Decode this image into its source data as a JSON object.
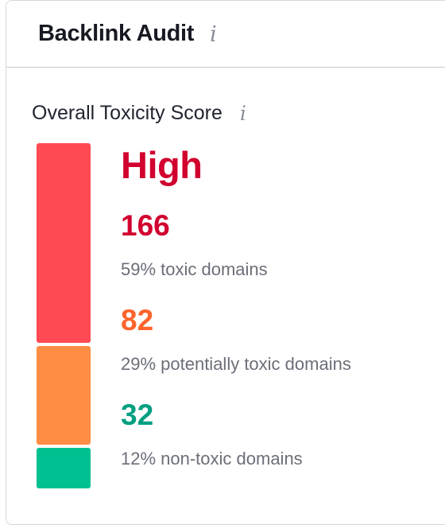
{
  "widget": {
    "title": "Backlink Audit",
    "info_glyph": "i",
    "info_icon": "info-icon"
  },
  "toxicity": {
    "label": "Overall Toxicity Score",
    "info_glyph": "i",
    "level": "High",
    "level_color": "#d1002f",
    "segments": [
      {
        "name": "toxic",
        "count": "166",
        "share": 0.59,
        "color": "#ff4953",
        "number_color": "#d1002f",
        "description": "59% toxic domains"
      },
      {
        "name": "potentially-toxic",
        "count": "82",
        "share": 0.29,
        "color": "#ff8c43",
        "number_color": "#ff642d",
        "description": "29% potentially toxic domains"
      },
      {
        "name": "non-toxic",
        "count": "32",
        "share": 0.12,
        "color": "#00c192",
        "number_color": "#009f81",
        "description": "12% non-toxic domains"
      }
    ]
  }
}
